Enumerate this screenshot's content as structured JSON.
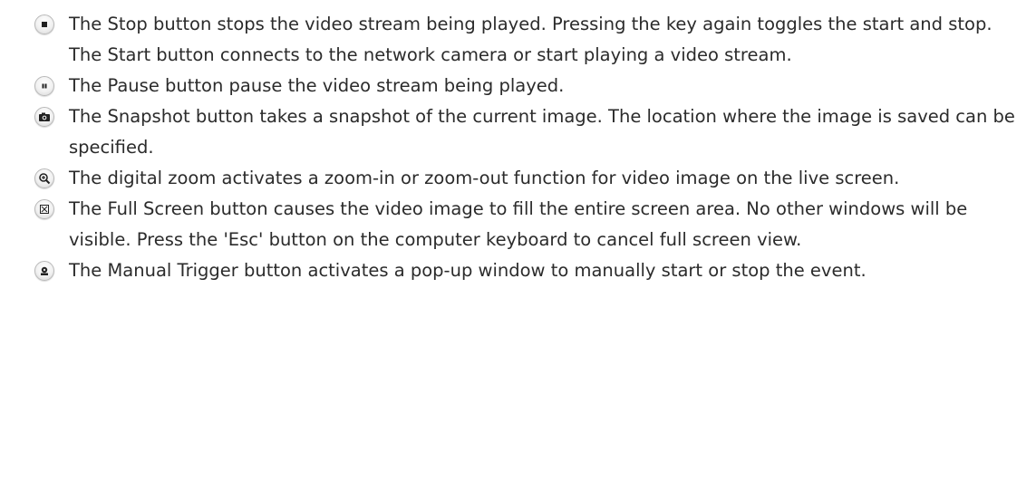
{
  "items": [
    {
      "icon": "stop-icon",
      "text": "The Stop button stops the video stream being played. Pressing the key again toggles the start and stop. The Start button connects to the network camera or start playing a video stream."
    },
    {
      "icon": "pause-icon",
      "text": "The Pause button pause the video stream being played."
    },
    {
      "icon": "camera-icon",
      "text": "The Snapshot button takes a snapshot of the current image. The location where the image is saved can be specified."
    },
    {
      "icon": "zoom-in-icon",
      "text": "The digital zoom activates a zoom-in or zoom-out function for video image on the live screen."
    },
    {
      "icon": "fullscreen-icon",
      "text": "The Full Screen button causes the video image to fill the entire screen area. No other windows will be visible. Press the 'Esc' button on the computer keyboard to cancel full screen view."
    },
    {
      "icon": "manual-trigger-icon",
      "text": "The Manual Trigger button activates a pop-up window to manually start or stop the event."
    }
  ]
}
